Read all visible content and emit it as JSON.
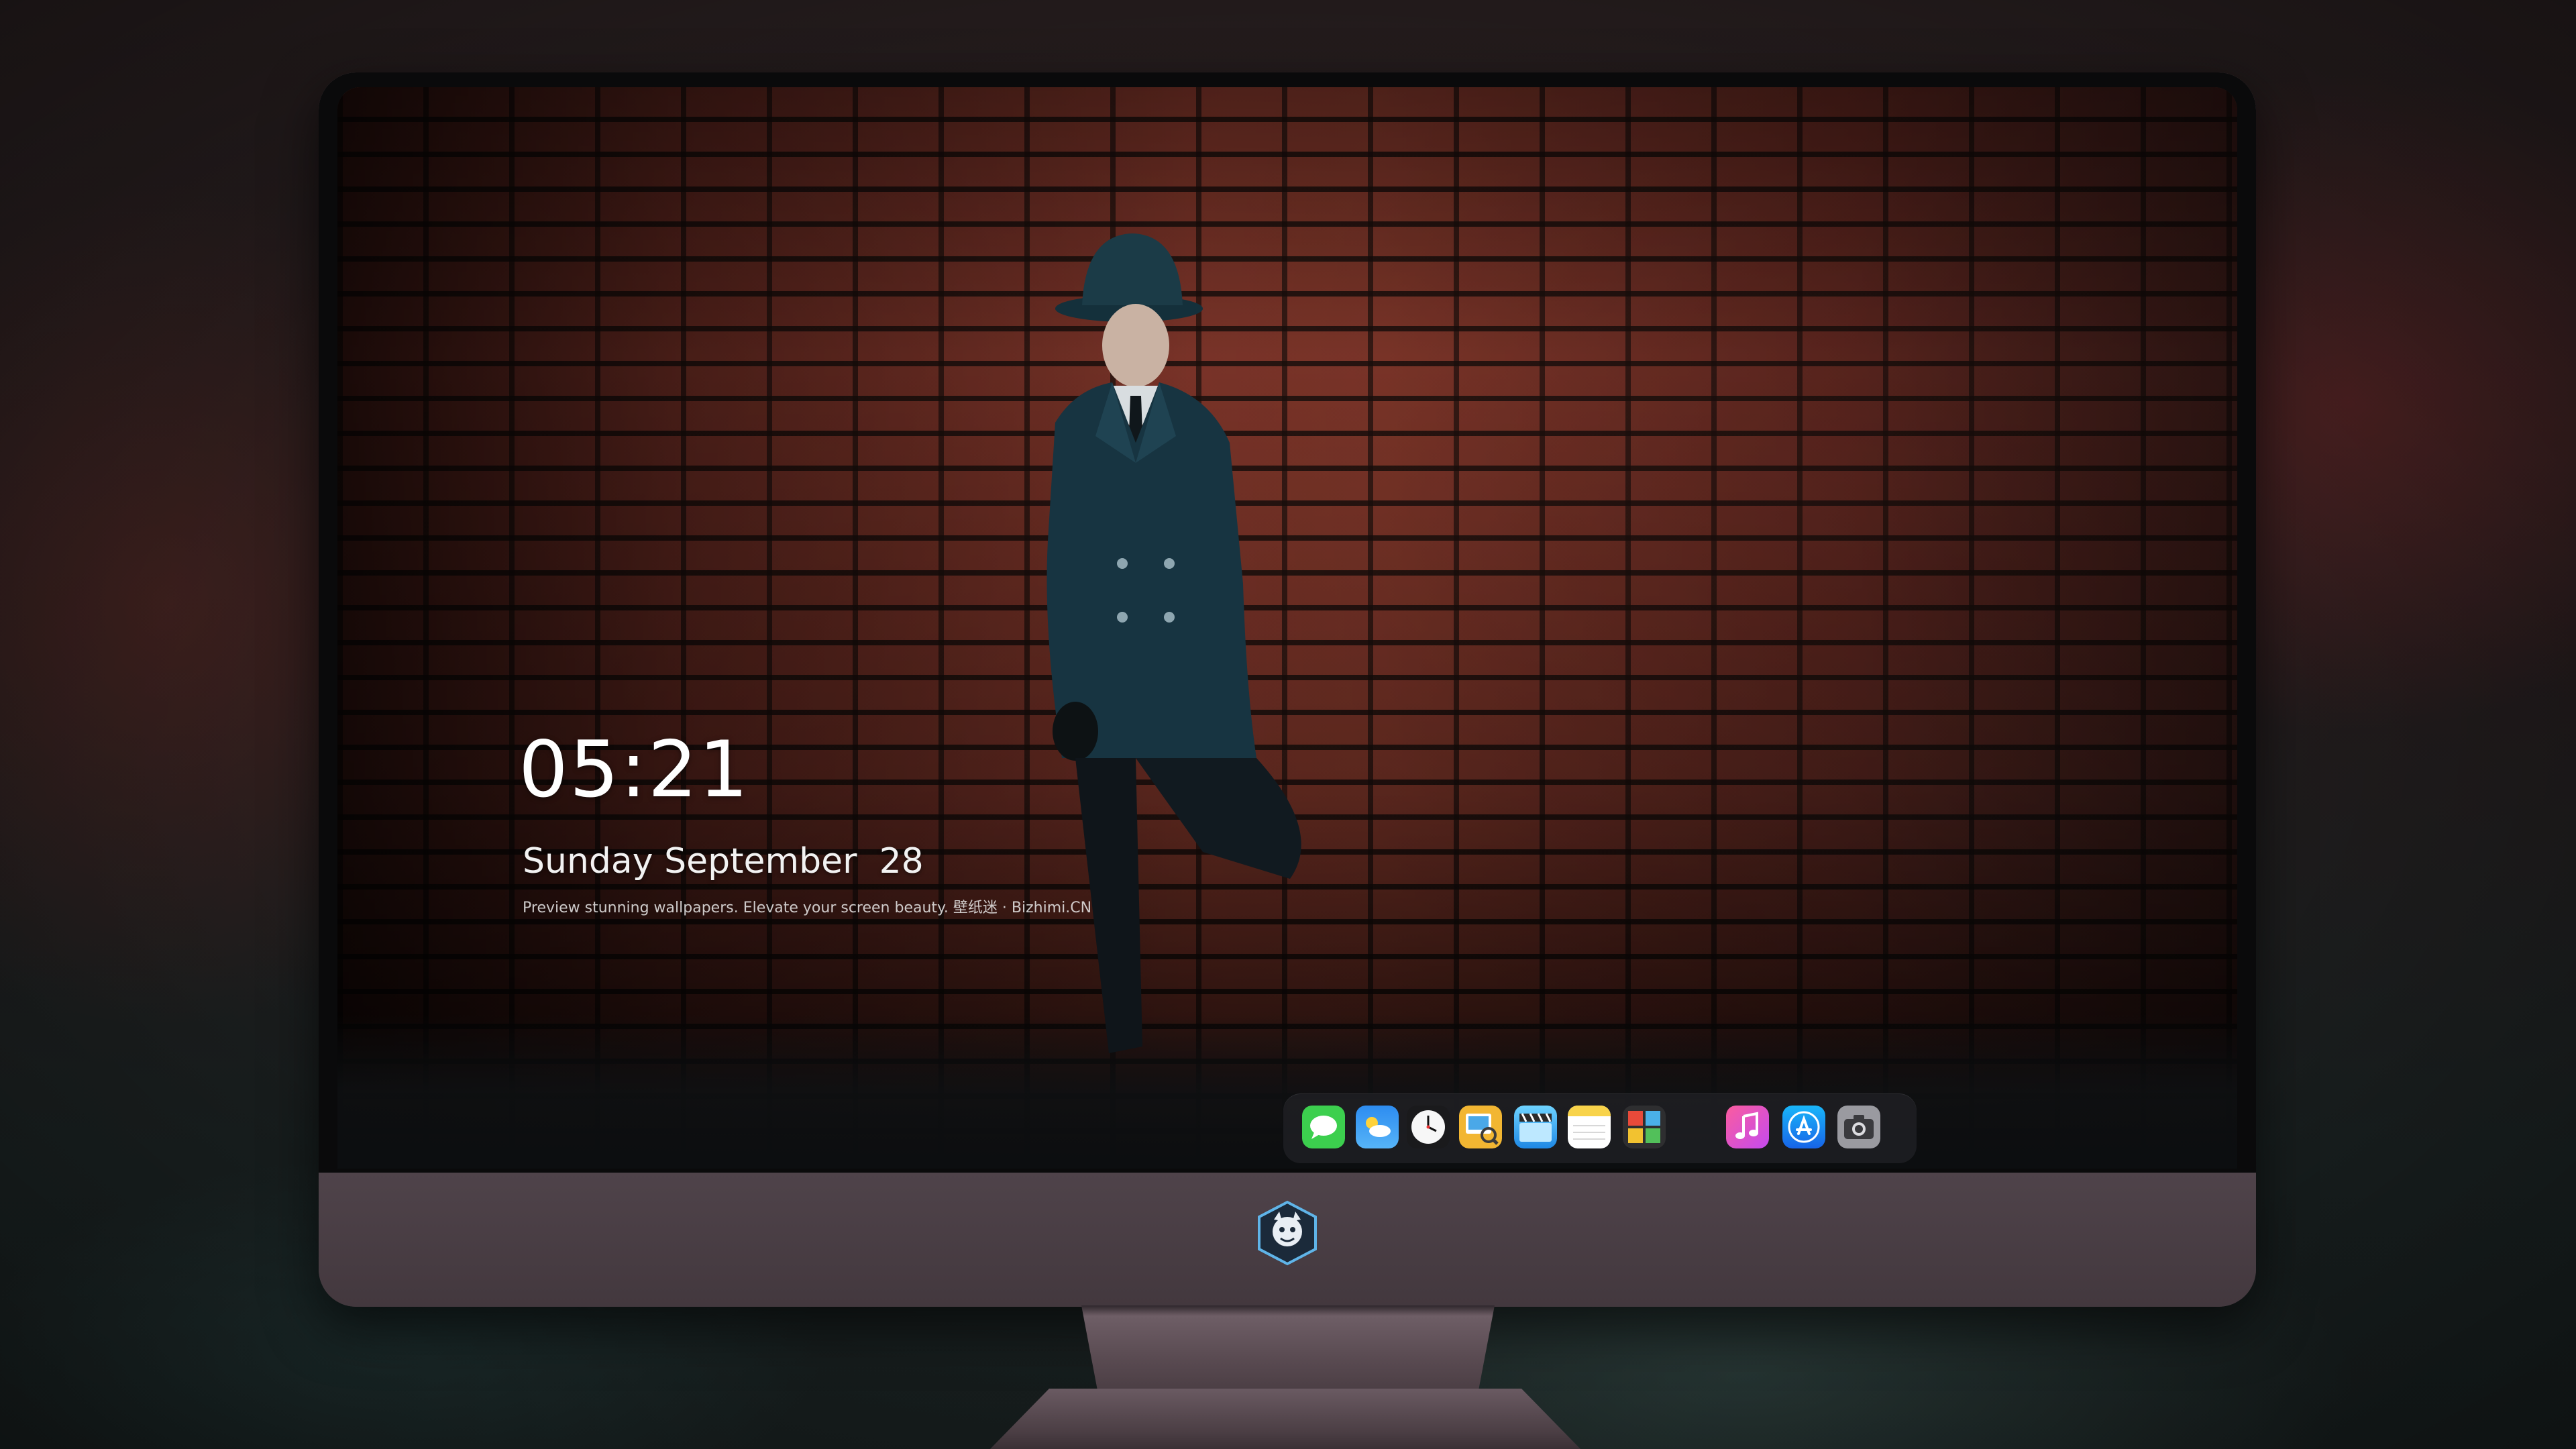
{
  "lockscreen": {
    "time": "05:21",
    "date": "Sunday September  28",
    "caption": "Preview stunning wallpapers. Elevate your screen beauty. 壁纸迷 · Bizhimi.CN"
  },
  "dock": {
    "items": [
      {
        "name": "messages-icon",
        "color": "#3ccf4e"
      },
      {
        "name": "weather-icon",
        "color": "#2f8cf5"
      },
      {
        "name": "clock-icon",
        "color": "#ffffff"
      },
      {
        "name": "preview-icon",
        "color": "#f2b632"
      },
      {
        "name": "clips-icon",
        "color": "#35a7f0"
      },
      {
        "name": "notes-icon",
        "color": "#f8d34a"
      },
      {
        "name": "photo-booth-icon",
        "color": "#e84a3a"
      },
      {
        "name": "music-icon",
        "color": "#f24d8a"
      },
      {
        "name": "app-store-icon",
        "color": "#1d8df2"
      },
      {
        "name": "camera-icon",
        "color": "#8e8e93"
      }
    ]
  },
  "colors": {
    "monitor_chin": "#4a3e44",
    "bezel": "#0a0a0b",
    "text": "#ffffff"
  }
}
